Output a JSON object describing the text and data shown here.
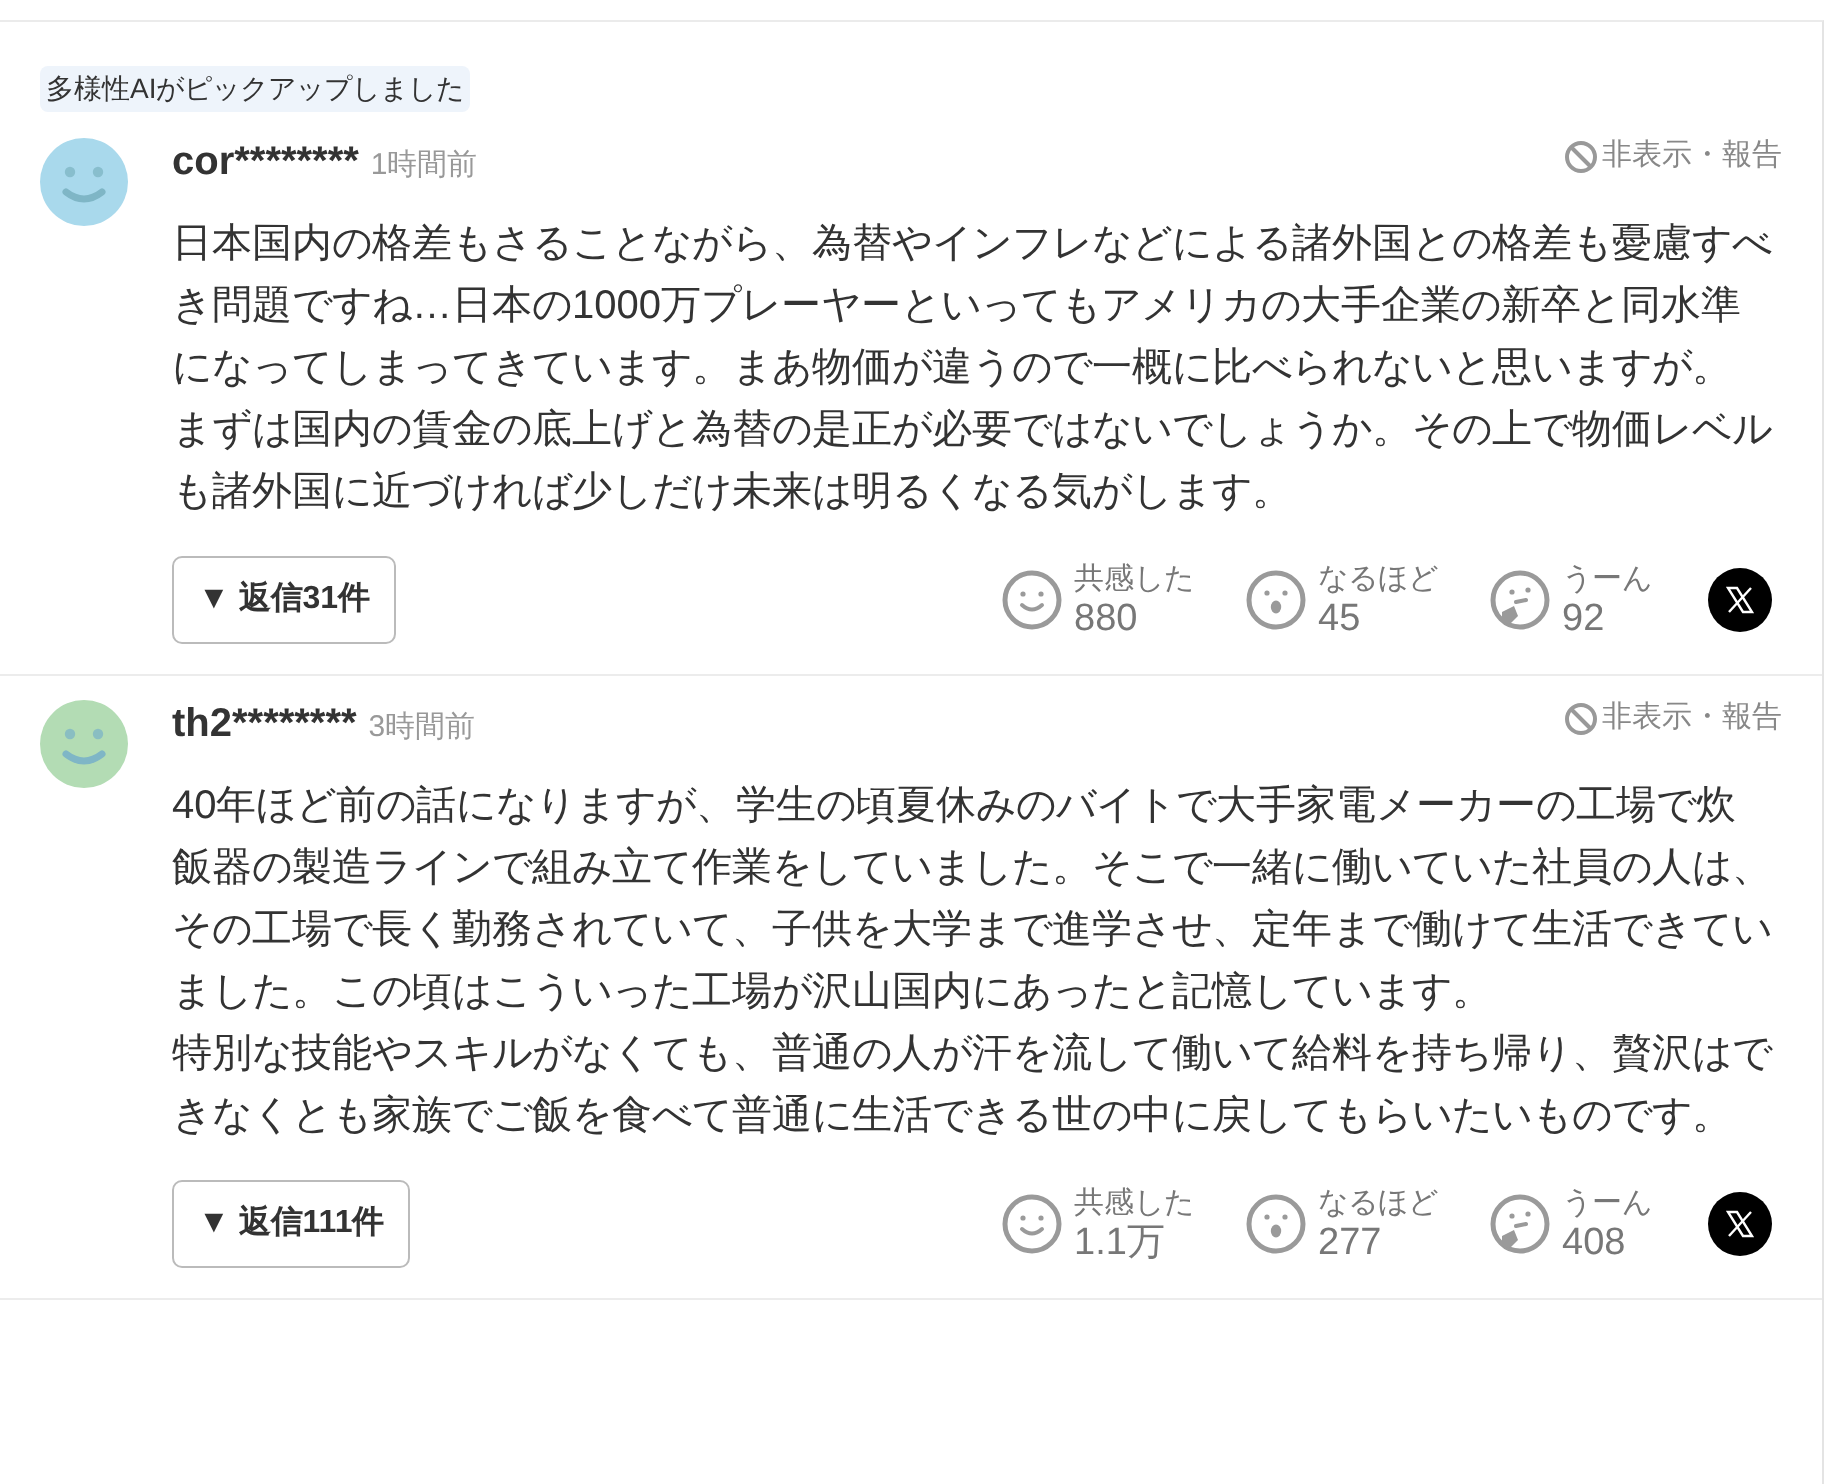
{
  "pickup_badge": "多様性AIがピックアップしました",
  "comments": [
    {
      "color": "#a9d9ec",
      "username": "cor********",
      "time": "1時間前",
      "report": "非表示・報告",
      "paragraphs": [
        "日本国内の格差もさることながら、為替やインフレなどによる諸外国との格差も憂慮すべき問題ですね…日本の1000万プレーヤーといってもアメリカの大手企業の新卒と同水準になってしまってきています。まあ物価が違うので一概に比べられないと思いますが。",
        "まずは国内の賃金の底上げと為替の是正が必要ではないでしょうか。その上で物価レベルも諸外国に近づければ少しだけ未来は明るくなる気がします。"
      ],
      "replies": "▼ 返信31件",
      "reactions": [
        {
          "kind": "smile",
          "label": "共感した",
          "count": "880"
        },
        {
          "kind": "surprise",
          "label": "なるほど",
          "count": "45"
        },
        {
          "kind": "think",
          "label": "うーん",
          "count": "92"
        }
      ]
    },
    {
      "color": "#b3dcb4",
      "username": "th2********",
      "time": "3時間前",
      "report": "非表示・報告",
      "paragraphs": [
        "40年ほど前の話になりますが、学生の頃夏休みのバイトで大手家電メーカーの工場で炊飯器の製造ラインで組み立て作業をしていました。そこで一緒に働いていた社員の人は、その工場で長く勤務されていて、子供を大学まで進学させ、定年まで働けて生活できていました。この頃はこういった工場が沢山国内にあったと記憶しています。",
        "特別な技能やスキルがなくても、普通の人が汗を流して働いて給料を持ち帰り、贅沢はできなくとも家族でご飯を食べて普通に生活できる世の中に戻してもらいたいものです。"
      ],
      "replies": "▼ 返信111件",
      "reactions": [
        {
          "kind": "smile",
          "label": "共感した",
          "count": "1.1万"
        },
        {
          "kind": "surprise",
          "label": "なるほど",
          "count": "277"
        },
        {
          "kind": "think",
          "label": "うーん",
          "count": "408"
        }
      ]
    }
  ]
}
